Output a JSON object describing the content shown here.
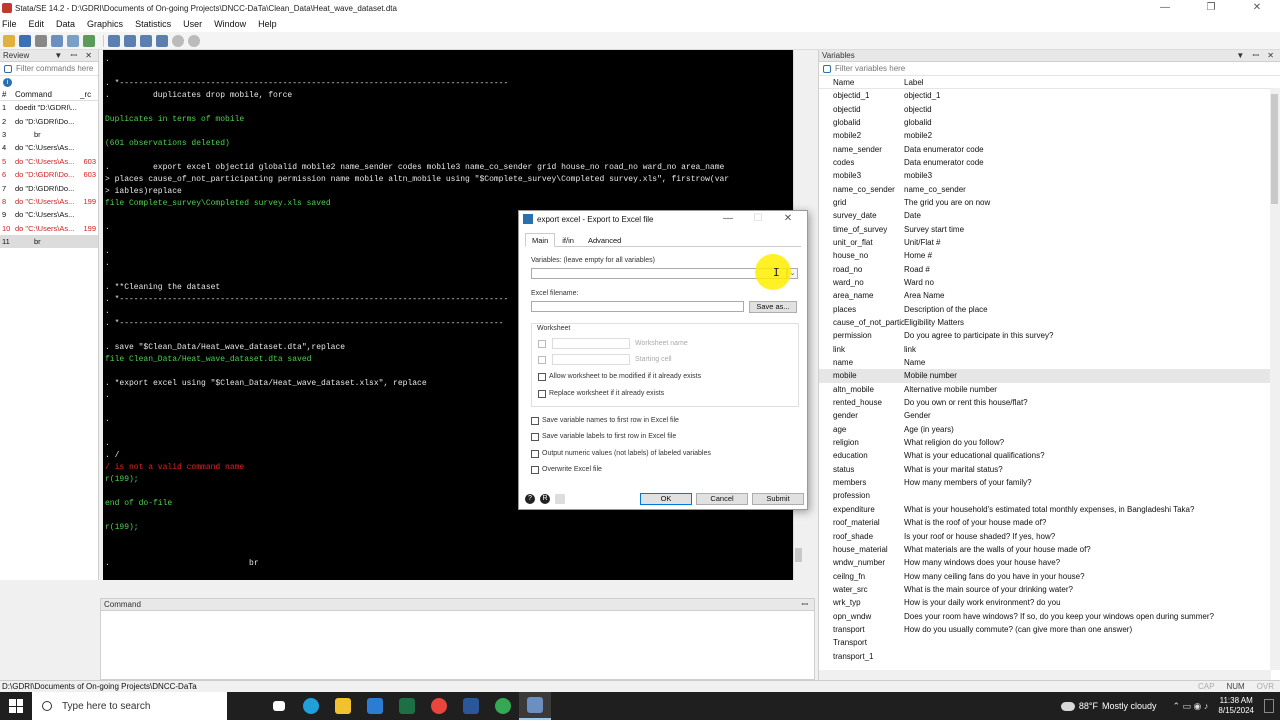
{
  "window": {
    "title": "Stata/SE 14.2 - D:\\GDRI\\Documents of On-going Projects\\DNCC-DaTa\\Clean_Data\\Heat_wave_dataset.dta",
    "minimize": "—",
    "maximize": "❐",
    "close": "✕"
  },
  "menu": [
    "File",
    "Edit",
    "Data",
    "Graphics",
    "Statistics",
    "User",
    "Window",
    "Help"
  ],
  "review": {
    "title": "Review",
    "filter_placeholder": "Filter commands here",
    "col_num": "#",
    "col_command": "Command",
    "col_rc": "_rc",
    "rows": [
      {
        "n": "1",
        "cmd": "doedit \"D:\\GDRI\\...",
        "rc": "",
        "err": false
      },
      {
        "n": "2",
        "cmd": "do \"D:\\GDRI\\Do...",
        "rc": "",
        "err": false
      },
      {
        "n": "3",
        "cmd": "br",
        "rc": "",
        "err": false
      },
      {
        "n": "4",
        "cmd": "do \"C:\\Users\\As...",
        "rc": "",
        "err": false
      },
      {
        "n": "5",
        "cmd": "do \"C:\\Users\\As...",
        "rc": "603",
        "err": true
      },
      {
        "n": "6",
        "cmd": "do \"D:\\GDRI\\Do...",
        "rc": "603",
        "err": true
      },
      {
        "n": "7",
        "cmd": "do \"D:\\GDRI\\Do...",
        "rc": "",
        "err": false
      },
      {
        "n": "8",
        "cmd": "do \"C:\\Users\\As...",
        "rc": "199",
        "err": true
      },
      {
        "n": "9",
        "cmd": "do \"C:\\Users\\As...",
        "rc": "",
        "err": false
      },
      {
        "n": "10",
        "cmd": "do \"C:\\Users\\As...",
        "rc": "199",
        "err": true
      },
      {
        "n": "11",
        "cmd": "br",
        "rc": "",
        "err": false
      }
    ]
  },
  "results": {
    "lines": [
      {
        "t": ".",
        "c": "w"
      },
      {
        "t": "",
        "c": "w"
      },
      {
        "t": ". *---------------------------------------------------------------------------------",
        "c": "w"
      },
      {
        "t": ".         duplicates drop mobile, force",
        "c": "w"
      },
      {
        "t": "",
        "c": "w"
      },
      {
        "t": "Duplicates in terms of mobile",
        "c": "g"
      },
      {
        "t": "",
        "c": "w"
      },
      {
        "t": "(601 observations deleted)",
        "c": "g"
      },
      {
        "t": "",
        "c": "w"
      },
      {
        "t": ".         export excel objectid globalid mobile2 name_sender codes mobile3 name_co_sender grid house_no road_no ward_no area_name",
        "c": "w"
      },
      {
        "t": "> places cause_of_not_participating permission name mobile altn_mobile using \"$Complete_survey\\Completed survey.xls\", firstrow(var",
        "c": "w"
      },
      {
        "t": "> iables)replace",
        "c": "w"
      },
      {
        "t": "file Complete_survey\\Completed survey.xls saved",
        "c": "g"
      },
      {
        "t": "",
        "c": "w"
      },
      {
        "t": ".",
        "c": "w"
      },
      {
        "t": "",
        "c": "w"
      },
      {
        "t": ".",
        "c": "w"
      },
      {
        "t": ".",
        "c": "w"
      },
      {
        "t": "",
        "c": "w"
      },
      {
        "t": ". **Cleaning the dataset",
        "c": "w"
      },
      {
        "t": ". *---------------------------------------------------------------------------------",
        "c": "w"
      },
      {
        "t": ".",
        "c": "w"
      },
      {
        "t": ". *--------------------------------------------------------------------------------",
        "c": "w"
      },
      {
        "t": "",
        "c": "w"
      },
      {
        "t": ". save \"$Clean_Data/Heat_wave_dataset.dta\",replace",
        "c": "w"
      },
      {
        "t": "file Clean_Data/Heat_wave_dataset.dta saved",
        "c": "g"
      },
      {
        "t": "",
        "c": "w"
      },
      {
        "t": ". *export excel using \"$Clean_Data/Heat_wave_dataset.xlsx\", replace",
        "c": "w"
      },
      {
        "t": ".",
        "c": "w"
      },
      {
        "t": "",
        "c": "w"
      },
      {
        "t": ".",
        "c": "w"
      },
      {
        "t": "",
        "c": "w"
      },
      {
        "t": ".",
        "c": "w"
      },
      {
        "t": ". /",
        "c": "w"
      },
      {
        "t": "/ is not a valid command name",
        "c": "r"
      },
      {
        "t": "r(199);",
        "c": "g"
      },
      {
        "t": "",
        "c": "w"
      },
      {
        "t": "end of do-file",
        "c": "g"
      },
      {
        "t": "",
        "c": "w"
      },
      {
        "t": "r(199);",
        "c": "g"
      },
      {
        "t": "",
        "c": "w"
      },
      {
        "t": "",
        "c": "w"
      },
      {
        "t": ".                             br",
        "c": "w"
      }
    ]
  },
  "command": {
    "title": "Command"
  },
  "variables": {
    "title": "Variables",
    "filter_placeholder": "Filter variables here",
    "col_name": "Name",
    "col_label": "Label",
    "selected": "mobile",
    "rows": [
      {
        "name": "objectid_1",
        "label": "objectid_1"
      },
      {
        "name": "objectid",
        "label": "objectid"
      },
      {
        "name": "globalid",
        "label": "globalid"
      },
      {
        "name": "mobile2",
        "label": "mobile2"
      },
      {
        "name": "name_sender",
        "label": "Data enumerator code"
      },
      {
        "name": "codes",
        "label": "Data enumerator code"
      },
      {
        "name": "mobile3",
        "label": "mobile3"
      },
      {
        "name": "name_co_sender",
        "label": "name_co_sender"
      },
      {
        "name": "grid",
        "label": "The grid you are on now"
      },
      {
        "name": "survey_date",
        "label": "Date"
      },
      {
        "name": "time_of_survey",
        "label": "Survey start time"
      },
      {
        "name": "unit_or_flat",
        "label": "Unit/Flat #"
      },
      {
        "name": "house_no",
        "label": "Home #"
      },
      {
        "name": "road_no",
        "label": "Road #"
      },
      {
        "name": "ward_no",
        "label": "Ward no"
      },
      {
        "name": "area_name",
        "label": "Area Name"
      },
      {
        "name": "places",
        "label": "Description of the place"
      },
      {
        "name": "cause_of_not_particip...",
        "label": "Eligibility Matters"
      },
      {
        "name": "permission",
        "label": "Do you agree to participate in this survey?"
      },
      {
        "name": "link",
        "label": "link"
      },
      {
        "name": "name",
        "label": "Name"
      },
      {
        "name": "mobile",
        "label": "Mobile number"
      },
      {
        "name": "altn_mobile",
        "label": "Alternative mobile number"
      },
      {
        "name": "rented_house",
        "label": "Do you own or rent this house/flat?"
      },
      {
        "name": "gender",
        "label": "Gender"
      },
      {
        "name": "age",
        "label": "Age (in years)"
      },
      {
        "name": "religion",
        "label": "What religion do you follow?"
      },
      {
        "name": "education",
        "label": "What is your educational qualifications?"
      },
      {
        "name": "status",
        "label": "What is your marital status?"
      },
      {
        "name": "members",
        "label": "How many members of your family?"
      },
      {
        "name": "profession",
        "label": ""
      },
      {
        "name": "expenditure",
        "label": "What is your household's estimated total monthly expenses, in Bangladeshi Taka?"
      },
      {
        "name": "roof_material",
        "label": "What is the roof of your house made of?"
      },
      {
        "name": "roof_shade",
        "label": "Is your roof or house shaded? If yes, how?"
      },
      {
        "name": "house_material",
        "label": "What materials are the walls of your house made of?"
      },
      {
        "name": "wndw_number",
        "label": "How many windows does your house have?"
      },
      {
        "name": "ceilng_fn",
        "label": "How many ceiling fans do you have in your house?"
      },
      {
        "name": "water_src",
        "label": "What is the main source of your drinking water?"
      },
      {
        "name": "wrk_typ",
        "label": "How is your daily work environment? do you"
      },
      {
        "name": "opn_wndw",
        "label": "Does your room have windows? If so, do you keep your windows open during summer?"
      },
      {
        "name": "transport",
        "label": "How do you usually commute? (can give more than one answer)"
      },
      {
        "name": "Transport",
        "label": ""
      },
      {
        "name": "transport_1",
        "label": ""
      }
    ]
  },
  "statusbar": {
    "path": "D:\\GDRI\\Documents of On-going Projects\\DNCC-DaTa",
    "cap": "CAP",
    "num": "NUM",
    "ovr": "OVR"
  },
  "dialog": {
    "title": "export excel - Export to Excel file",
    "tabs": [
      "Main",
      "if/in",
      "Advanced"
    ],
    "variables_label": "Variables: (leave empty for all variables)",
    "excel_filename_label": "Excel filename:",
    "save_as": "Save as...",
    "worksheet_group": "Worksheet",
    "worksheet_name": "Worksheet name",
    "starting_cell": "Starting cell",
    "allow_modify": "Allow worksheet to be modified if it already exists",
    "replace_ws": "Replace worksheet if it already exists",
    "save_names": "Save variable names to first row in Excel file",
    "save_labels": "Save variable labels to first row in Excel file",
    "output_numeric": "Output numeric values (not labels) of labeled variables",
    "overwrite": "Overwrite Excel file",
    "ok": "OK",
    "cancel": "Cancel",
    "submit": "Submit"
  },
  "taskbar": {
    "search_placeholder": "Type here to search",
    "weather_temp": "88°F",
    "weather_text": "Mostly cloudy",
    "time": "11:38 AM",
    "date": "8/15/2024"
  },
  "colors": {
    "results_bg": "#000000",
    "result_green": "#4fd04f",
    "result_red": "#e02020",
    "error_red": "#d42020",
    "accent_blue": "#0078d7",
    "cursor_highlight": "#ffee00"
  }
}
